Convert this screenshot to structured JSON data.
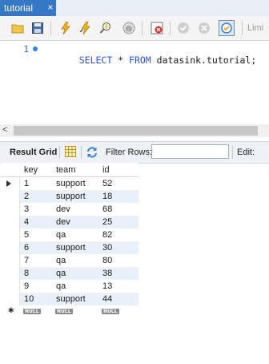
{
  "tab": {
    "title": "tutorial",
    "close": "×"
  },
  "toolbar": {
    "buttons": [
      {
        "name": "open-sql-file-icon"
      },
      {
        "name": "save-icon"
      },
      {
        "name": "execute-lightning-icon"
      },
      {
        "name": "execute-cursor-lightning-icon"
      },
      {
        "name": "explain-magnifier-icon"
      },
      {
        "name": "stop-icon"
      },
      {
        "name": "toggle-error-icon"
      },
      {
        "name": "commit-check-icon"
      },
      {
        "name": "rollback-x-icon"
      },
      {
        "name": "autocommit-toggle-icon"
      }
    ],
    "limit_label": "Limi",
    "accent": "#3578c6"
  },
  "editor": {
    "line_number": "1",
    "tokens": [
      {
        "text": "SELECT",
        "kind": "kw"
      },
      {
        "text": " * ",
        "kind": "tx"
      },
      {
        "text": "FROM",
        "kind": "kw"
      },
      {
        "text": " datasink.tutorial;",
        "kind": "tx"
      }
    ]
  },
  "hscroll": {
    "left_arrow": "<"
  },
  "result_bar": {
    "label": "Result Grid",
    "filter_label": "Filter Rows:",
    "filter_value": "",
    "edit_label": "Edit:"
  },
  "grid": {
    "columns": [
      "key",
      "team",
      "id"
    ],
    "rows": [
      [
        "1",
        "support",
        "52"
      ],
      [
        "2",
        "support",
        "18"
      ],
      [
        "3",
        "dev",
        "68"
      ],
      [
        "4",
        "dev",
        "25"
      ],
      [
        "5",
        "qa",
        "82"
      ],
      [
        "6",
        "support",
        "30"
      ],
      [
        "7",
        "qa",
        "80"
      ],
      [
        "8",
        "qa",
        "38"
      ],
      [
        "9",
        "qa",
        "13"
      ],
      [
        "10",
        "support",
        "44"
      ]
    ],
    "null_label": "NULL",
    "new_row_marker": "✱",
    "stripe_color": "#e9f0fa"
  }
}
